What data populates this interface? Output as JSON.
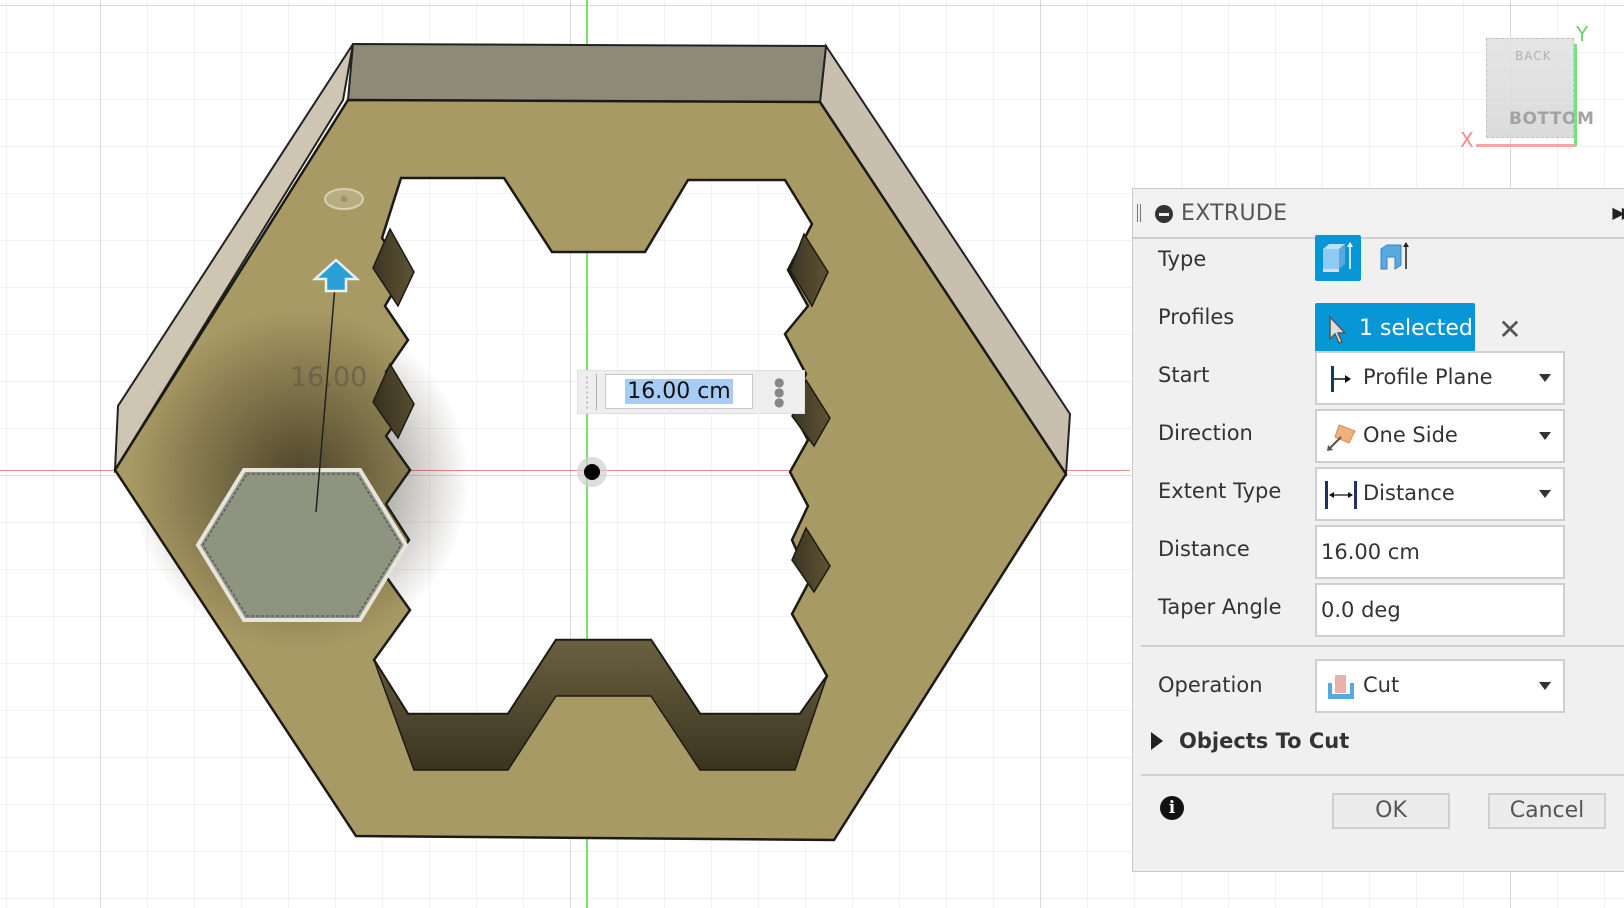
{
  "viewport": {
    "dimension_label": "16.00",
    "inline_distance_value": "16.00 cm",
    "viewcube": {
      "face_top": "BACK",
      "face_front": "BOTTOM",
      "axis_x": "X",
      "axis_y": "Y"
    },
    "colors": {
      "body": "#a89a64",
      "body_side": "#c9bfae",
      "back_wall": "#8f8a78",
      "profile": "#8f9480",
      "x_axis": "#ef8a8a",
      "y_axis": "#7ddc6e",
      "manipulator_arrow": "#2a9fd6"
    }
  },
  "panel": {
    "title": "EXTRUDE",
    "expand_icon": "double-chevron-right",
    "rows": {
      "type": {
        "label": "Type",
        "options": [
          "solid-extrude-icon",
          "thin-extrude-icon"
        ],
        "selected": 0
      },
      "profiles": {
        "label": "Profiles",
        "value": "1 selected"
      },
      "start": {
        "label": "Start",
        "value": "Profile Plane"
      },
      "direction": {
        "label": "Direction",
        "value": "One Side"
      },
      "extent_type": {
        "label": "Extent Type",
        "value": "Distance"
      },
      "distance": {
        "label": "Distance",
        "value": "16.00 cm"
      },
      "taper_angle": {
        "label": "Taper Angle",
        "value": "0.0 deg"
      },
      "operation": {
        "label": "Operation",
        "value": "Cut"
      }
    },
    "objects_to_cut": "Objects To Cut",
    "ok_label": "OK",
    "cancel_label": "Cancel",
    "accent": "#0897d6"
  }
}
